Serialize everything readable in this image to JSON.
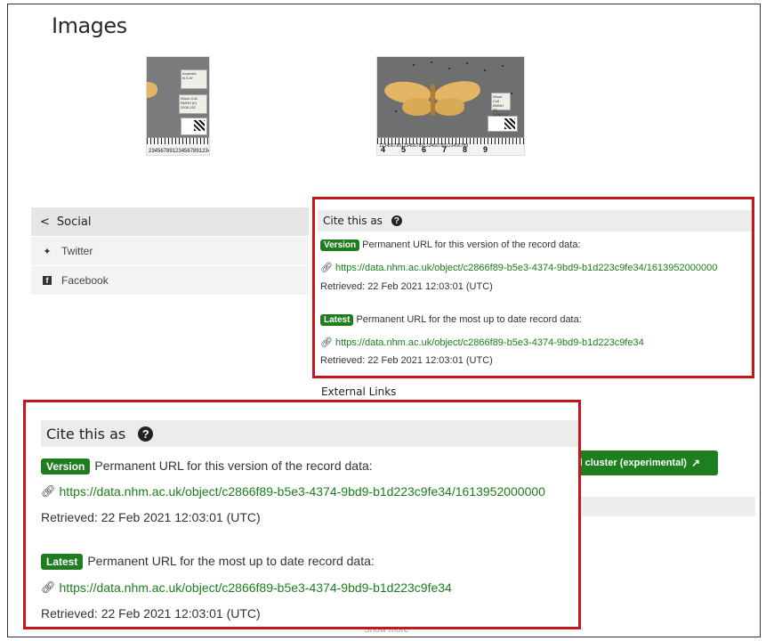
{
  "page": {
    "title": "Images"
  },
  "specimens": [
    {
      "label_lines": [
        "Australia",
        "N.S.W.",
        "...",
        "Wood Coll.",
        "BMNH (E)",
        "2008-152"
      ],
      "ruler_text": "234567891234567891234"
    },
    {
      "label_lines": [
        "Wood Coll.",
        "BMNH (E)",
        "2008-152"
      ],
      "ruler_text": "456789",
      "ruler_small": "123456789123456789123456789123456789"
    }
  ],
  "social": {
    "heading": "Social",
    "items": [
      {
        "label": "Twitter",
        "icon": "twitter-icon"
      },
      {
        "label": "Facebook",
        "icon": "facebook-icon"
      }
    ]
  },
  "cite": {
    "heading": "Cite this as",
    "help_glyph": "?",
    "version": {
      "badge": "Version",
      "description": "Permanent URL for this version of the record data:",
      "url": "https://data.nhm.ac.uk/object/c2866f89-b5e3-4374-9bd9-b1d223c9fe34/1613952000000",
      "retrieved": "Retrieved: 22 Feb 2021 12:03:01 (UTC)"
    },
    "latest": {
      "badge": "Latest",
      "description": "Permanent URL for the most up to date record data:",
      "url": "https://data.nhm.ac.uk/object/c2866f89-b5e3-4374-9bd9-b1d223c9fe34",
      "retrieved": "Retrieved: 22 Feb 2021 12:03:01 (UTC)"
    }
  },
  "external_links": {
    "heading": "External Links",
    "cluster_button": "rd cluster (experimental)"
  },
  "show_more": "Show more",
  "colors": {
    "accent_green": "#1f7d1f",
    "link_green": "#1a7f1a",
    "highlight_red": "#c4161c"
  }
}
